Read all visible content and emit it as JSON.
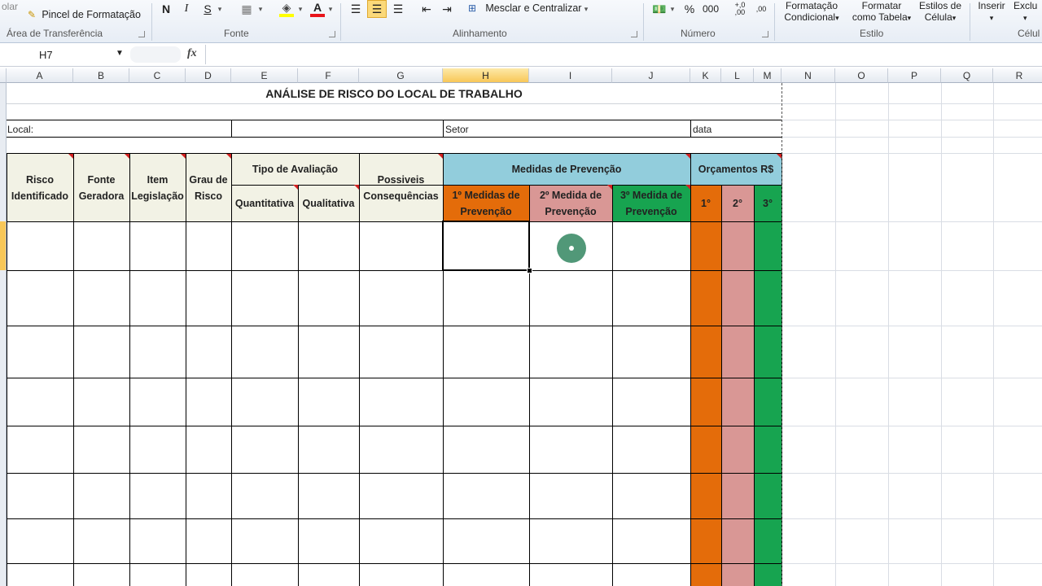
{
  "ribbon": {
    "clipboard_cut": "olar",
    "format_painter": "Pincel de Formatação",
    "group_clipboard": "Área de Transferência",
    "group_font": "Fonte",
    "bold": "N",
    "italic": "I",
    "underline": "S",
    "group_alignment": "Alinhamento",
    "merge_center": "Mesclar e Centralizar",
    "group_number": "Número",
    "percent": "%",
    "thousands": "000",
    "cond_format_1": "Formatação",
    "cond_format_2": "Condicional",
    "format_table_1": "Formatar",
    "format_table_2": "como Tabela",
    "cell_styles_1": "Estilos de",
    "cell_styles_2": "Célula",
    "group_style": "Estilo",
    "insert": "Inserir",
    "delete": "Exclu",
    "group_cells": "Célul"
  },
  "formula_bar": {
    "name_box": "H7",
    "fx": "fx",
    "value": ""
  },
  "columns": [
    "A",
    "B",
    "C",
    "D",
    "E",
    "F",
    "G",
    "H",
    "I",
    "J",
    "K",
    "L",
    "M",
    "N",
    "O",
    "P",
    "Q",
    "R"
  ],
  "sheet": {
    "title": "ANÁLISE DE RISCO DO LOCAL DE TRABALHO",
    "local_label": "Local:",
    "setor_label": "Setor",
    "data_label": "data",
    "h_risco": "Risco Identificado",
    "h_fonte": "Fonte Geradora",
    "h_item": "Item Legislação",
    "h_grau": "Grau de Risco",
    "h_tipo": "Tipo de Avaliação",
    "h_quant": "Quantitativa",
    "h_qual": "Qualitativa",
    "h_poss": "Possiveis Consequências",
    "h_medidas": "Medidas de Prevenção",
    "h_med1": "1º Medidas de Prevenção",
    "h_med2": "2º Medida de Prevenção",
    "h_med3": "3º Medida de Prevenção",
    "h_orc": "Orçamentos R$",
    "h_o1": "1°",
    "h_o2": "2°",
    "h_o3": "3°"
  },
  "colors": {
    "header_fill": "#f2f2e5",
    "medidas_fill": "#92cddc",
    "orange": "#e46c0a",
    "pink": "#d99795",
    "green": "#17a450",
    "selection": "#f8c758"
  }
}
